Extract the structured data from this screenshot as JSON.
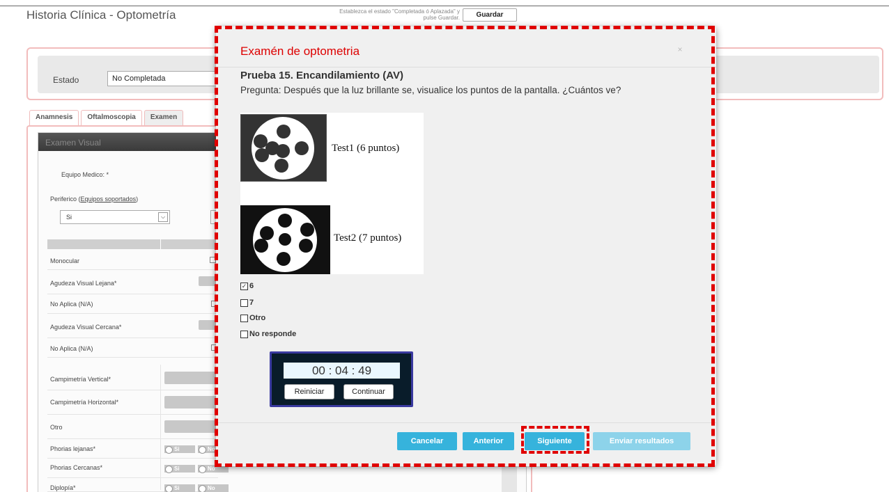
{
  "page": {
    "title": "Historia Clínica - Optometría",
    "save_hint": "Establezca el estado \"Completada ó Aplazada\" y pulse Guardar.",
    "save_button": "Guardar"
  },
  "estado": {
    "label": "Estado",
    "value": "No Completada"
  },
  "tabs": [
    "Anamnesis",
    "Oftalmoscopia",
    "Examen"
  ],
  "exam": {
    "header": "Examen Visual",
    "equipo_label": "Equipo Medico: *",
    "periferico_label": "Periferico (",
    "periferico_link": "Equipos soportados",
    "periferico_close": ")",
    "periferico_value": "Si",
    "rows": {
      "monocular": "Monocular",
      "av_lejana": "Agudeza Visual Lejana*",
      "na1": "No Aplica (N/A)",
      "av_cercana": "Agudeza Visual Cercana*",
      "na2": "No Aplica (N/A)",
      "campi_vertical": "Campimetría Vertical*",
      "campi_horizontal": "Campimetría Horizontal*",
      "otro": "Otro",
      "phorias_lejanas": "Phorias lejanas*",
      "phorias_cercanas": "Phorias Cercanas*",
      "diplopia": "Diplopía*"
    },
    "radio_si": "Si",
    "radio_no": "No"
  },
  "modal": {
    "title": "Examén de optometria",
    "close": "×",
    "question_title": "Prueba 15. Encandilamiento (AV)",
    "question_text": "Pregunta: Después que la luz brillante se, visualice los puntos de la pantalla. ¿Cuántos ve?",
    "test1_label": "Test1 (6 puntos)",
    "test2_label": "Test2 (7 puntos)",
    "options": [
      {
        "label": "6",
        "checked": true
      },
      {
        "label": "7",
        "checked": false
      },
      {
        "label": "Otro",
        "checked": false
      },
      {
        "label": "No responde",
        "checked": false
      }
    ],
    "timer": {
      "display": "00 : 04 : 49",
      "reset": "Reiniciar",
      "continue": "Continuar"
    },
    "buttons": {
      "cancel": "Cancelar",
      "previous": "Anterior",
      "next": "Siguiente",
      "send": "Enviar resultados"
    }
  },
  "colors": {
    "accent": "#36b3dc",
    "highlight": "#e00000",
    "title_red": "#dd0000"
  }
}
